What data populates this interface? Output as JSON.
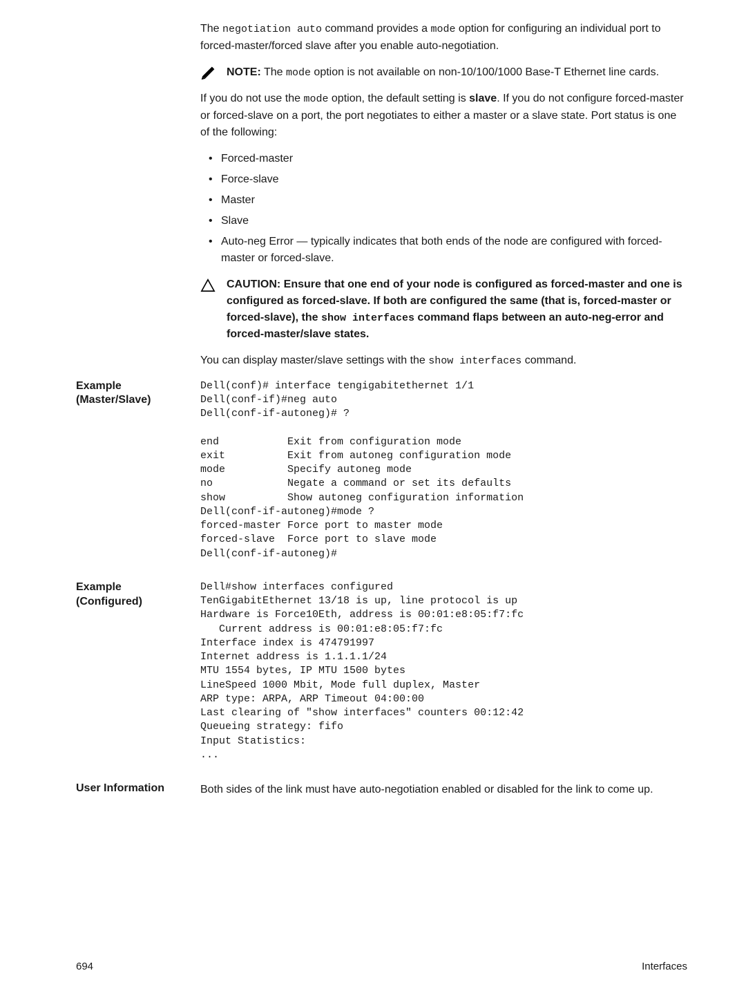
{
  "intro": {
    "p1a": "The ",
    "p1code": "negotiation auto",
    "p1b": " command provides a ",
    "p1code2": "mode",
    "p1c": " option for configuring an individual port to forced-master/forced slave after you enable auto-negotiation."
  },
  "note": {
    "label": "NOTE:",
    "a": " The ",
    "code": "mode",
    "b": " option is not available on non-10/100/1000 Base-T Ethernet line cards."
  },
  "p2": {
    "a": "If you do not use the ",
    "code": "mode",
    "b": " option, the default setting is ",
    "bold": "slave",
    "c": ". If you do not configure forced-master or forced-slave on a port, the port negotiates to either a master or a slave state. Port status is one of the following:"
  },
  "bullets": [
    "Forced-master",
    "Force-slave",
    "Master",
    "Slave",
    "Auto-neg Error — typically indicates that both ends of the node are configured with forced-master or forced-slave."
  ],
  "caution": {
    "label": "CAUTION: ",
    "a": "Ensure that one end of your node is configured as forced-master and one is configured as forced-slave. If both are configured the same (that is, forced-master or forced-slave), the ",
    "code": "show interfaces",
    "b": " command flaps between an auto-neg-error and forced-master/slave states."
  },
  "p3": {
    "a": "You can display master/slave settings with the ",
    "code": "show interfaces",
    "b": " command."
  },
  "example1": {
    "label": "Example (Master/Slave)",
    "code": "Dell(conf)# interface tengigabitethernet 1/1\nDell(conf-if)#neg auto\nDell(conf-if-autoneg)# ?\n\nend           Exit from configuration mode\nexit          Exit from autoneg configuration mode\nmode          Specify autoneg mode\nno            Negate a command or set its defaults\nshow          Show autoneg configuration information\nDell(conf-if-autoneg)#mode ?\nforced-master Force port to master mode\nforced-slave  Force port to slave mode\nDell(conf-if-autoneg)#"
  },
  "example2": {
    "label": "Example (Configured)",
    "code": "Dell#show interfaces configured\nTenGigabitEthernet 13/18 is up, line protocol is up\nHardware is Force10Eth, address is 00:01:e8:05:f7:fc\n   Current address is 00:01:e8:05:f7:fc\nInterface index is 474791997\nInternet address is 1.1.1.1/24\nMTU 1554 bytes, IP MTU 1500 bytes\nLineSpeed 1000 Mbit, Mode full duplex, Master\nARP type: ARPA, ARP Timeout 04:00:00\nLast clearing of \"show interfaces\" counters 00:12:42\nQueueing strategy: fifo\nInput Statistics:\n..."
  },
  "user_info": {
    "label": "User Information",
    "text": "Both sides of the link must have auto-negotiation enabled or disabled for the link to come up."
  },
  "footer": {
    "page": "694",
    "chapter": "Interfaces"
  }
}
